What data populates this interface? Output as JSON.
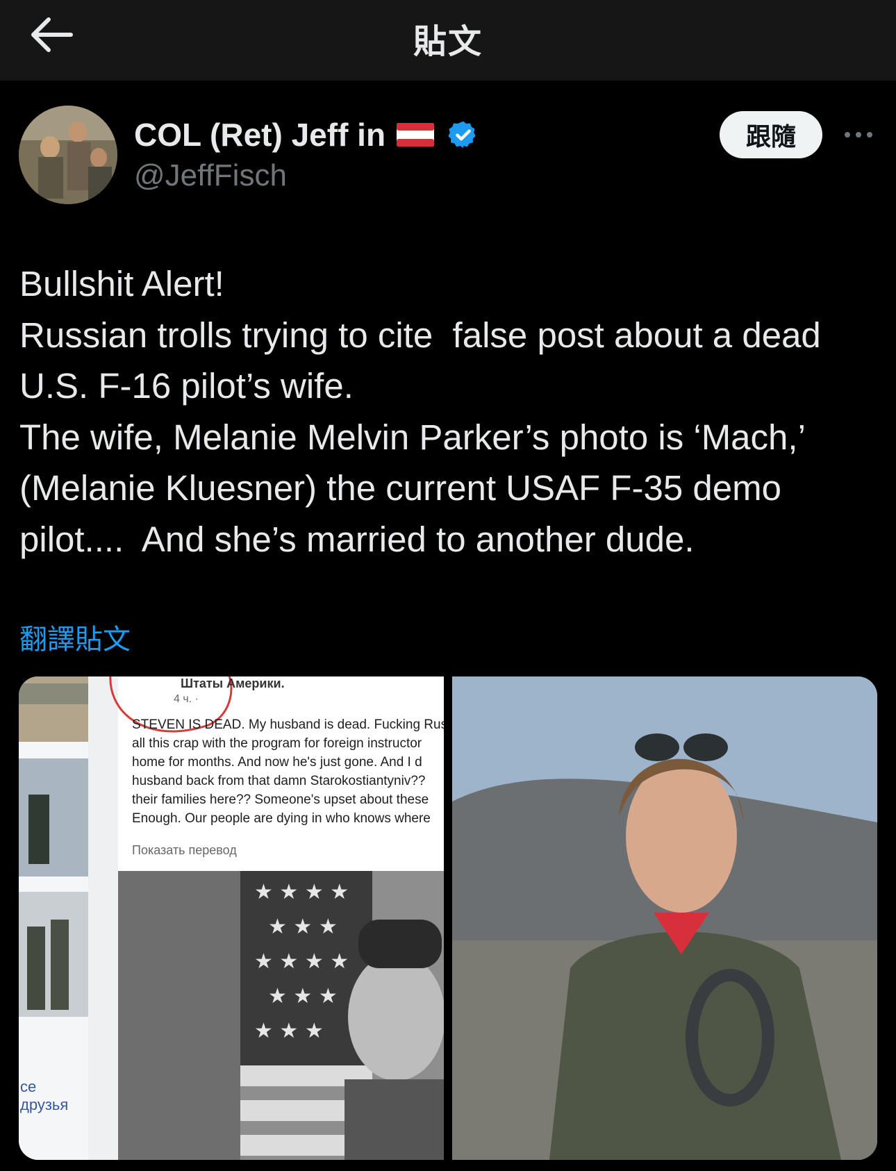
{
  "topbar": {
    "title": "貼文"
  },
  "author": {
    "display_name": "COL (Ret) Jeff in",
    "flag_icon": "austria-flag-icon",
    "verified_icon": "verified-badge-icon",
    "handle": "@JeffFisch",
    "follow_label": "跟隨"
  },
  "post": {
    "lines": [
      "Bullshit Alert!",
      "Russian trolls trying to cite  false post about a dead",
      "U.S. F-16 pilot’s wife.",
      "The wife, Melanie Melvin Parker’s photo is ‘Mach,’",
      "(Melanie Kluesner) the current USAF F-35 demo",
      "pilot....  And she’s married to another dude."
    ],
    "translate_label": "翻譯貼文"
  },
  "media": {
    "left": {
      "header": "Штаты Америки.",
      "time": "4 ч. ·",
      "text_lines": [
        "STEVEN IS DEAD. My husband is dead. Fucking Rus",
        "all this crap with the program for foreign instructor",
        "home for months. And now he's just gone. And I d",
        "husband back from that damn Starokostiantyniv??",
        "their families here?? Someone's upset about these",
        "Enough. Our people are dying in who knows where"
      ],
      "translate": "Показать перевод",
      "friends": "се друзья"
    }
  },
  "colors": {
    "accent": "#1d9bf0",
    "background": "#000000",
    "topbar": "#161616"
  }
}
